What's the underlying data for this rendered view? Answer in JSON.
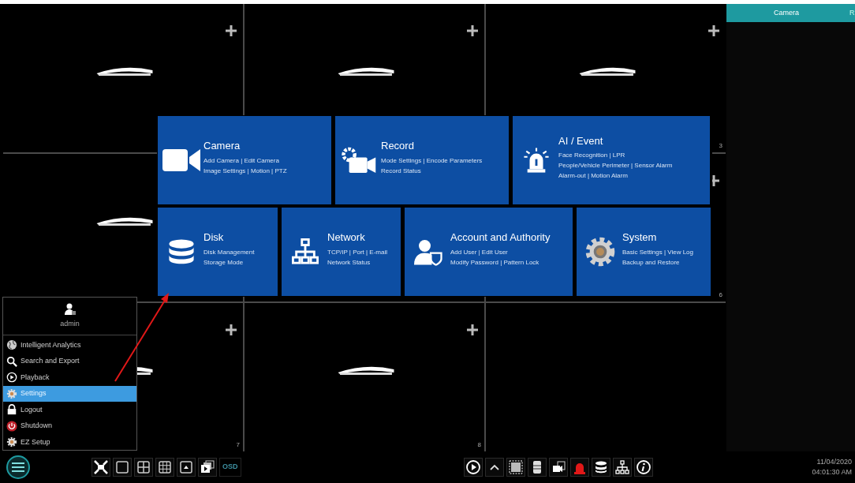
{
  "video_grid": {
    "cells": [
      {
        "logo": true,
        "add": true
      },
      {
        "logo": true,
        "add": true
      },
      {
        "logo": true,
        "add": true,
        "number": "3"
      },
      {
        "logo": true,
        "add": false
      },
      {},
      {
        "logo": false,
        "add": true,
        "number": "6"
      },
      {
        "logo": true,
        "add": true,
        "number": "7"
      },
      {
        "logo": true,
        "add": true,
        "number": "8"
      },
      {
        "logo": false,
        "add": false
      }
    ]
  },
  "settings_menu": {
    "top_row": [
      {
        "title": "Camera",
        "lines": [
          "Add Camera | Edit Camera",
          "Image Settings | Motion | PTZ"
        ]
      },
      {
        "title": "Record",
        "lines": [
          "Mode Settings | Encode Parameters",
          "Record Status"
        ]
      },
      {
        "title": "AI / Event",
        "lines": [
          "Face Recognition | LPR",
          "People/Vehicle Perimeter | Sensor Alarm",
          "Alarm-out | Motion Alarm"
        ]
      }
    ],
    "bottom_row": [
      {
        "title": "Disk",
        "lines": [
          "Disk Management",
          "Storage Mode"
        ]
      },
      {
        "title": "Network",
        "lines": [
          "TCP/IP | Port | E-mail",
          "Network Status"
        ]
      },
      {
        "title": "Account and Authority",
        "lines": [
          "Add User | Edit User",
          "Modify Password | Pattern Lock"
        ]
      },
      {
        "title": "System",
        "lines": [
          "Basic Settings | View Log",
          "Backup and Restore"
        ]
      }
    ]
  },
  "start_menu": {
    "user": "admin",
    "items": [
      {
        "label": "Intelligent Analytics",
        "selected": false
      },
      {
        "label": "Search and Export",
        "selected": false
      },
      {
        "label": "Playback",
        "selected": false
      },
      {
        "label": "Settings",
        "selected": true
      },
      {
        "label": "Logout",
        "selected": false
      },
      {
        "label": "Shutdown",
        "selected": false
      },
      {
        "label": "EZ Setup",
        "selected": false
      }
    ]
  },
  "right_panel": {
    "tabs": [
      {
        "label": "Camera",
        "selected": true
      },
      {
        "label": "R",
        "selected": false
      }
    ]
  },
  "toolbar": {
    "left_buttons": [
      {
        "kind": "fullscreen"
      },
      {
        "kind": "layout-1"
      },
      {
        "kind": "layout-4"
      },
      {
        "kind": "layout-9"
      },
      {
        "kind": "popup"
      },
      {
        "kind": "windows"
      },
      {
        "kind": "text",
        "label": "OSD"
      }
    ],
    "right_buttons": [
      {
        "kind": "play"
      },
      {
        "kind": "chevron"
      },
      {
        "kind": "frame"
      },
      {
        "kind": "storage"
      },
      {
        "kind": "camera"
      },
      {
        "kind": "alarm"
      },
      {
        "kind": "disk"
      },
      {
        "kind": "network"
      },
      {
        "kind": "info"
      }
    ],
    "date": "11/04/2020",
    "time": "04:01:30 AM"
  }
}
